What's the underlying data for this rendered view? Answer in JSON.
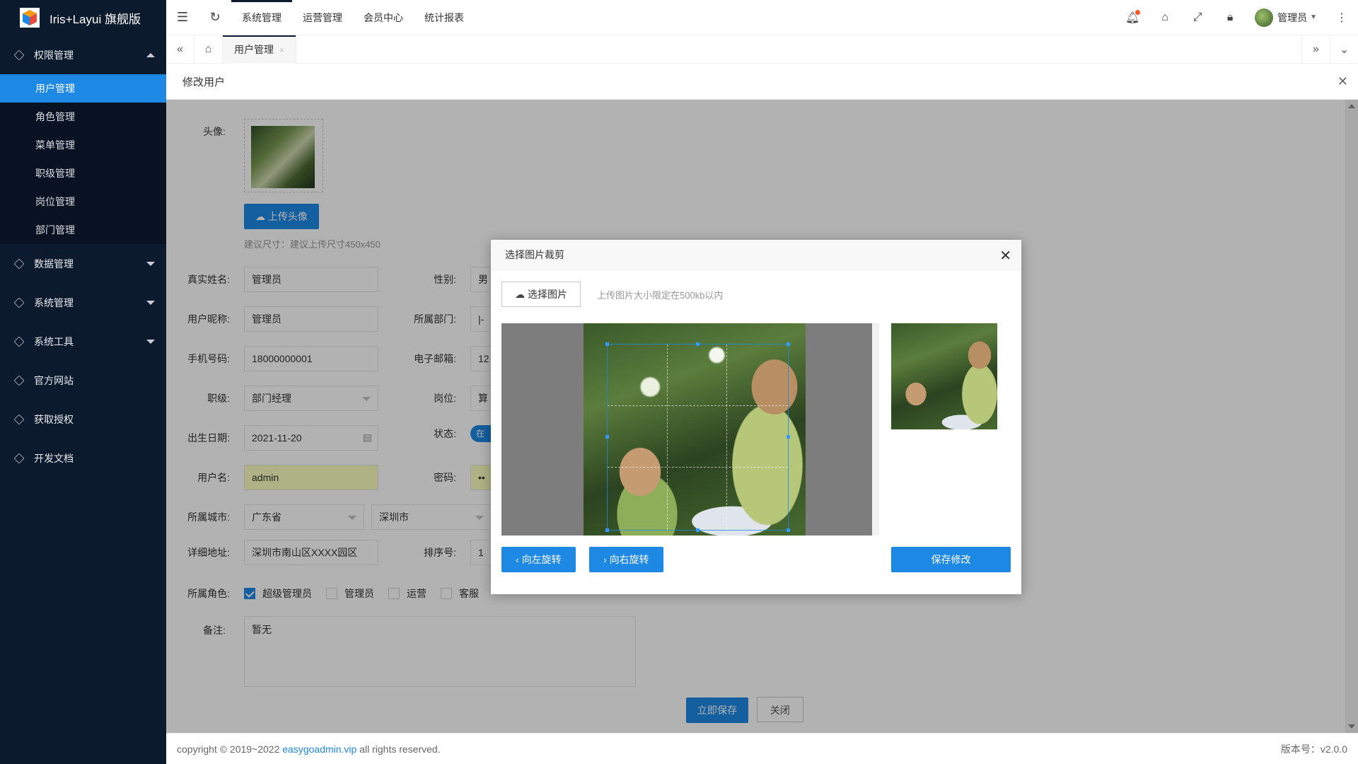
{
  "app": {
    "title": "Iris+Layui 旗舰版"
  },
  "sidebar": {
    "groups": [
      {
        "label": "权限管理",
        "expanded": true
      },
      {
        "label": "数据管理"
      },
      {
        "label": "系统管理"
      },
      {
        "label": "系统工具"
      },
      {
        "label": "官方网站"
      },
      {
        "label": "获取授权"
      },
      {
        "label": "开发文档"
      }
    ],
    "sub_items": [
      "用户管理",
      "角色管理",
      "菜单管理",
      "职级管理",
      "岗位管理",
      "部门管理"
    ]
  },
  "topbar": {
    "menus": [
      "系统管理",
      "运营管理",
      "会员中心",
      "统计报表"
    ],
    "user": "管理员"
  },
  "tabs": {
    "active": "用户管理",
    "close": "×"
  },
  "layer": {
    "title": "修改用户",
    "close": "✕"
  },
  "form": {
    "avatar_label": "头像:",
    "upload_btn": "上传头像",
    "size_hint": "建议尺寸：建议上传尺寸450x450",
    "realname_label": "真实姓名:",
    "realname": "管理员",
    "gender_label": "性别:",
    "gender": "男",
    "nickname_label": "用户昵称:",
    "nickname": "管理员",
    "dept_label": "所属部门:",
    "dept": "|-",
    "mobile_label": "手机号码:",
    "mobile": "18000000001",
    "email_label": "电子邮箱:",
    "email": "12",
    "level_label": "职级:",
    "level": "部门经理",
    "position_label": "岗位:",
    "position": "算",
    "birthday_label": "出生日期:",
    "birthday": "2021-11-20",
    "status_label": "状态:",
    "status": "在",
    "username_label": "用户名:",
    "username": "admin",
    "password_label": "密码:",
    "password": "••",
    "city_label": "所属城市:",
    "province": "广东省",
    "city": "深圳市",
    "address_label": "详细地址:",
    "address": "深圳市南山区XXXX园区",
    "sort_label": "排序号:",
    "sort": "1",
    "roles_label": "所属角色:",
    "roles": [
      {
        "label": "超级管理员",
        "checked": true
      },
      {
        "label": "管理员",
        "checked": false
      },
      {
        "label": "运营",
        "checked": false
      },
      {
        "label": "客服",
        "checked": false
      }
    ],
    "note_label": "备注:",
    "note": "暂无",
    "save_btn": "立即保存",
    "close_btn": "关闭"
  },
  "modal": {
    "title": "选择图片裁剪",
    "close": "✕",
    "choose_btn": "选择图片",
    "hint": "上传图片大小限定在500kb以内",
    "rotate_left": "向左旋转",
    "rotate_right": "向右旋转",
    "save": "保存修改"
  },
  "footer": {
    "copyright_pre": "copyright © 2019~2022 ",
    "link": "easygoadmin.vip",
    "copyright_post": " all rights reserved.",
    "version": "版本号：v2.0.0"
  },
  "colors": {
    "sidebar_bg": "#0c1a2e",
    "accent": "#1e88e5"
  }
}
